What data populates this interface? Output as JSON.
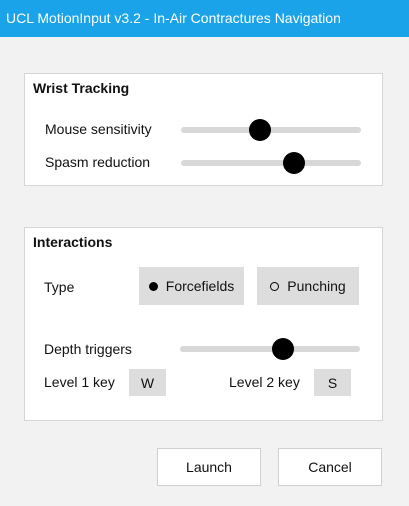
{
  "window": {
    "title": "UCL MotionInput v3.2 - In-Air Contractures Navigation"
  },
  "wrist_tracking": {
    "heading": "Wrist Tracking",
    "mouse_sensitivity": {
      "label": "Mouse sensitivity",
      "value": 0.44
    },
    "spasm_reduction": {
      "label": "Spasm reduction",
      "value": 0.63
    }
  },
  "interactions": {
    "heading": "Interactions",
    "type": {
      "label": "Type",
      "options": [
        {
          "label": "Forcefields",
          "selected": true
        },
        {
          "label": "Punching",
          "selected": false
        }
      ]
    },
    "depth_triggers": {
      "label": "Depth triggers",
      "value": 0.57
    },
    "level1": {
      "label": "Level 1 key",
      "value": "W"
    },
    "level2": {
      "label": "Level 2 key",
      "value": "S"
    }
  },
  "actions": {
    "launch": "Launch",
    "cancel": "Cancel"
  },
  "colors": {
    "titlebar": "#1aa3e8",
    "panel_bg": "#ffffff",
    "page_bg": "#f2f2f2",
    "button_grey": "#dddddd",
    "thumb": "#000000"
  }
}
